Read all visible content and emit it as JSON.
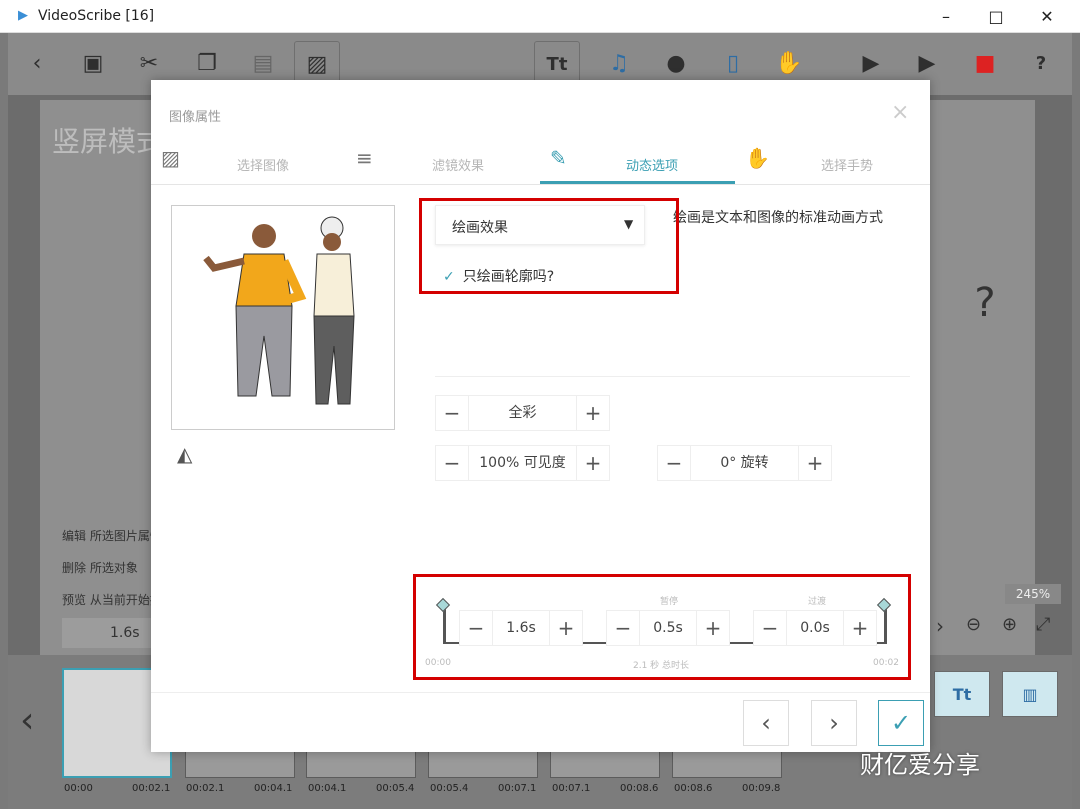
{
  "window": {
    "title": "VideoScribe [16]",
    "minimize": "–",
    "maximize": "□",
    "close": "✕"
  },
  "toolbar": {
    "icons": [
      "back-icon",
      "save-icon",
      "cut-icon",
      "copy-icon",
      "paste-icon",
      "image-icon",
      "text-icon",
      "music-icon",
      "microphone-icon",
      "document-icon",
      "hand-icon",
      "step-play-icon",
      "play-icon",
      "record-icon",
      "help-icon"
    ],
    "text_button": "Tt",
    "help": "?"
  },
  "stage": {
    "title": "竖屏模式"
  },
  "left_panel": {
    "edit": "编辑 所选图片属性",
    "delete": "删除 所选对象",
    "play_from": "预览 从当前开始播放",
    "duration": "1.6s"
  },
  "zoom": {
    "level": "245%"
  },
  "timeline": {
    "labels": [
      "00:00",
      "00:02.1",
      "00:02.1",
      "00:04.1",
      "00:04.1",
      "00:05.4",
      "00:05.4",
      "00:07.1",
      "00:07.1",
      "00:08.6",
      "00:08.6",
      "00:09.8"
    ]
  },
  "dialog": {
    "title": "图像属性",
    "close": "×",
    "tabs": [
      {
        "label": "选择图像",
        "icon": "image-icon"
      },
      {
        "label": "滤镜效果",
        "icon": "filter-icon"
      },
      {
        "label": "动态选项",
        "icon": "pencil-icon"
      },
      {
        "label": "选择手势",
        "icon": "hand-icon"
      }
    ],
    "active_tab": "动态选项",
    "animation": {
      "selected": "绘画效果",
      "description": "绘画是文本和图像的标准动画方式",
      "outline_only_label": "只绘画轮廓吗?",
      "outline_only_checked": true
    },
    "color": {
      "value": "全彩"
    },
    "visibility": {
      "value": "100% 可见度"
    },
    "rotation": {
      "value": "0° 旋转"
    },
    "timing": {
      "animate": "1.6s",
      "pause_label": "暂停",
      "pause": "0.5s",
      "transition_label": "过渡",
      "transition": "0.0s",
      "start": "00:00",
      "end": "00:02",
      "total": "2.1 秒 总时长"
    },
    "nav": {
      "prev": "‹",
      "next": "›",
      "ok": "✓"
    }
  },
  "bottom_buttons": {
    "text": "Tt"
  },
  "watermark": {
    "text": "财亿爱分享"
  }
}
